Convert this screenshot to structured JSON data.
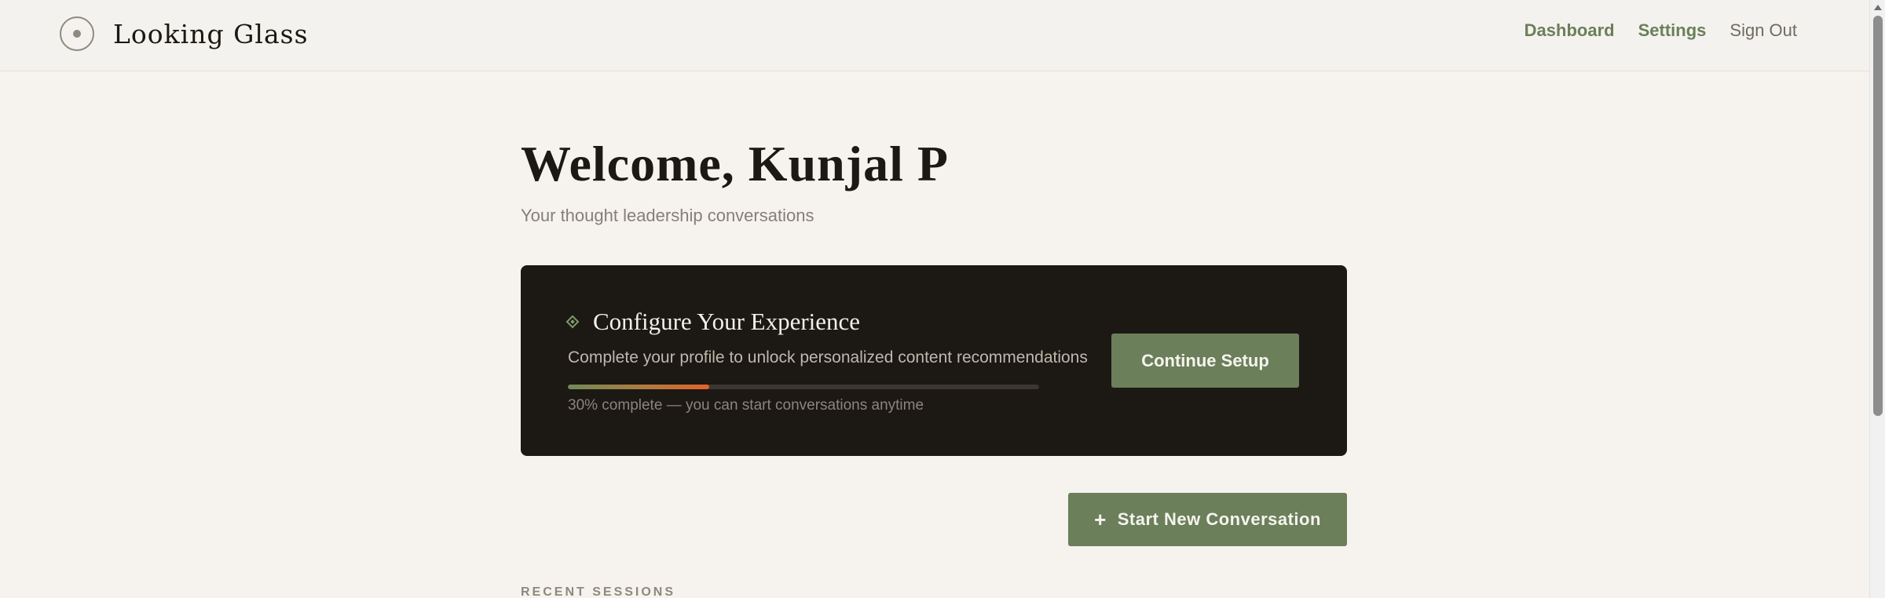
{
  "header": {
    "brand_name": "Looking Glass",
    "logo_icon": "looking-glass-logo-icon",
    "nav": {
      "dashboard": "Dashboard",
      "settings": "Settings",
      "sign_out": "Sign Out"
    }
  },
  "main": {
    "welcome": "Welcome, Kunjal P",
    "subtitle": "Your thought leadership conversations"
  },
  "setup_card": {
    "icon": "diamond-icon",
    "title": "Configure Your Experience",
    "description": "Complete your profile to unlock personalized content recommendations",
    "progress_percent": 30,
    "progress_text": "30% complete — you can start conversations anytime",
    "button_label": "Continue Setup"
  },
  "actions": {
    "start_icon": "plus-icon",
    "start_label": "Start New Conversation"
  },
  "recent": {
    "heading": "RECENT SESSIONS"
  },
  "colors": {
    "accent": "#6b7f5a",
    "background": "#f6f3ee",
    "card_background": "#1c1814",
    "progress_highlight": "#e0642c"
  }
}
